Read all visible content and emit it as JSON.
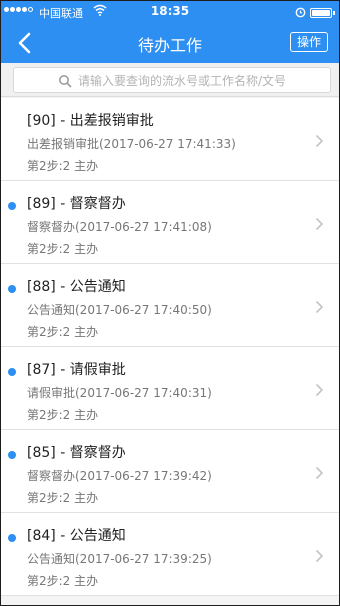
{
  "status_bar": {
    "carrier": "中国联通",
    "time": "18:35"
  },
  "nav": {
    "title": "待办工作",
    "action_label": "操作"
  },
  "search": {
    "placeholder": "请输入要查询的流水号或工作名称/文号"
  },
  "items": [
    {
      "title": "[90] - 出差报销审批",
      "subtitle": "出差报销审批(2017-06-27 17:41:33)",
      "step": "第2步:2 主办",
      "unread": false
    },
    {
      "title": "[89] - 督察督办",
      "subtitle": "督察督办(2017-06-27 17:41:08)",
      "step": "第2步:2 主办",
      "unread": true
    },
    {
      "title": "[88] - 公告通知",
      "subtitle": "公告通知(2017-06-27 17:40:50)",
      "step": "第2步:2 主办",
      "unread": true
    },
    {
      "title": "[87] - 请假审批",
      "subtitle": "请假审批(2017-06-27 17:40:31)",
      "step": "第2步:2 主办",
      "unread": true
    },
    {
      "title": "[85] - 督察督办",
      "subtitle": "督察督办(2017-06-27 17:39:42)",
      "step": "第2步:2 主办",
      "unread": true
    },
    {
      "title": "[84] - 公告通知",
      "subtitle": "公告通知(2017-06-27 17:39:25)",
      "step": "第2步:2 主办",
      "unread": true
    }
  ],
  "colors": {
    "accent": "#2c8ff1",
    "background": "#f4f4f4"
  }
}
